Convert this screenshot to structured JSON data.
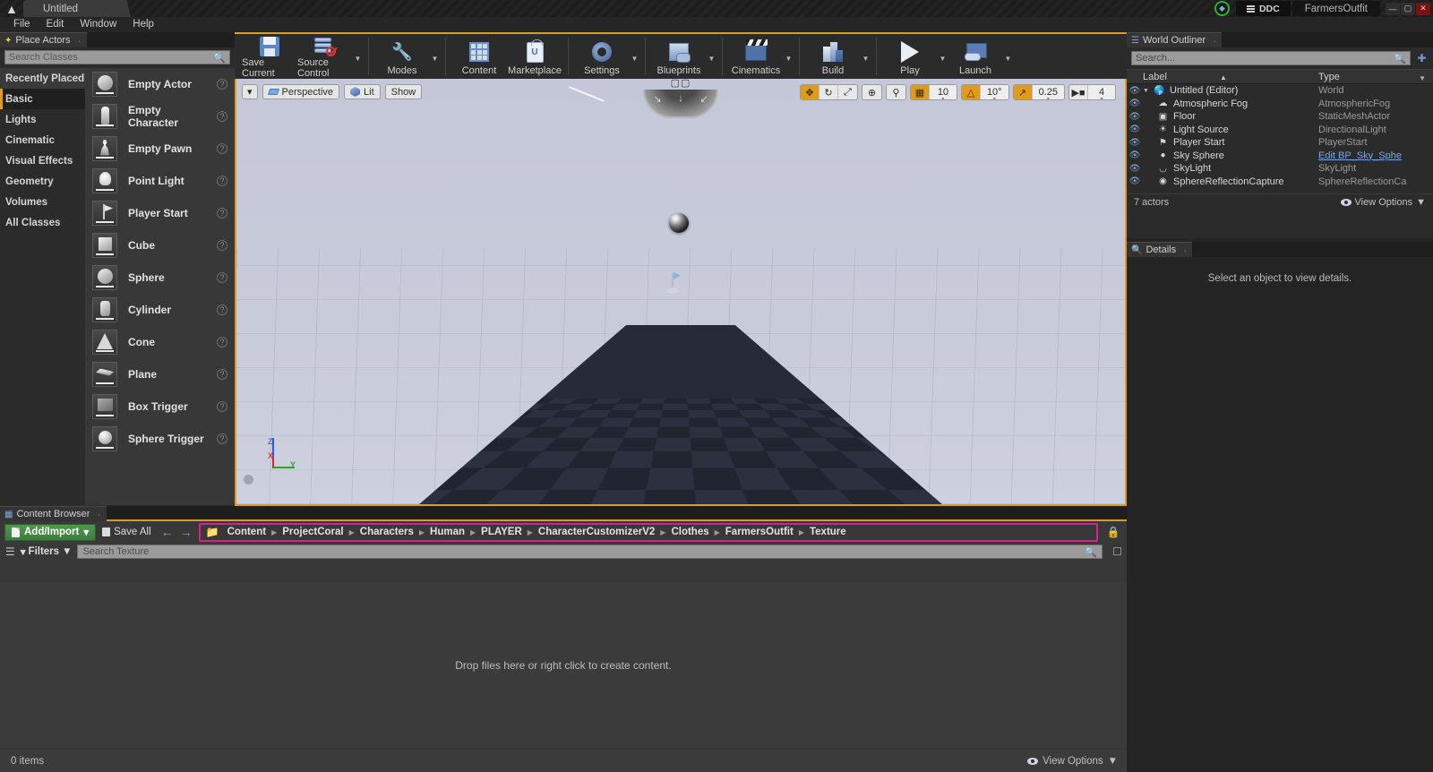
{
  "titlebar": {
    "project_tab": "Untitled",
    "ddc_label": "DDC",
    "window_label": "FarmersOutfit",
    "minimize": "—",
    "maximize": "▢",
    "close": "✕"
  },
  "menubar": {
    "items": [
      "File",
      "Edit",
      "Window",
      "Help"
    ]
  },
  "place_actors": {
    "tab_label": "Place Actors",
    "search_placeholder": "Search Classes",
    "categories": [
      {
        "label": "Recently Placed",
        "active": false,
        "highlight": true
      },
      {
        "label": "Basic",
        "active": true,
        "highlight": false
      },
      {
        "label": "Lights",
        "active": false,
        "highlight": false
      },
      {
        "label": "Cinematic",
        "active": false,
        "highlight": false
      },
      {
        "label": "Visual Effects",
        "active": false,
        "highlight": false
      },
      {
        "label": "Geometry",
        "active": false,
        "highlight": false
      },
      {
        "label": "Volumes",
        "active": false,
        "highlight": false
      },
      {
        "label": "All Classes",
        "active": false,
        "highlight": false
      }
    ],
    "actors": [
      {
        "label": "Empty Actor",
        "shape": "sphere"
      },
      {
        "label": "Empty Character",
        "shape": "char"
      },
      {
        "label": "Empty Pawn",
        "shape": "pawn"
      },
      {
        "label": "Point Light",
        "shape": "bulb"
      },
      {
        "label": "Player Start",
        "shape": "flag"
      },
      {
        "label": "Cube",
        "shape": "cube"
      },
      {
        "label": "Sphere",
        "shape": "sphere"
      },
      {
        "label": "Cylinder",
        "shape": "cyl"
      },
      {
        "label": "Cone",
        "shape": "cone"
      },
      {
        "label": "Plane",
        "shape": "plane"
      },
      {
        "label": "Box Trigger",
        "shape": "boxtrig"
      },
      {
        "label": "Sphere Trigger",
        "shape": "sphtrig"
      }
    ],
    "help_glyph": "?"
  },
  "toolbar": {
    "items": [
      {
        "label": "Save Current",
        "icon": "save-icon",
        "caret": false
      },
      {
        "label": "Source Control",
        "icon": "source-control-icon",
        "caret": true
      },
      {
        "label": "Modes",
        "icon": "modes-icon",
        "caret": true
      },
      {
        "label": "Content",
        "icon": "content-icon",
        "caret": false
      },
      {
        "label": "Marketplace",
        "icon": "marketplace-icon",
        "caret": false
      },
      {
        "label": "Settings",
        "icon": "settings-icon",
        "caret": true
      },
      {
        "label": "Blueprints",
        "icon": "blueprints-icon",
        "caret": true
      },
      {
        "label": "Cinematics",
        "icon": "cinematics-icon",
        "caret": true
      },
      {
        "label": "Build",
        "icon": "build-icon",
        "caret": true
      },
      {
        "label": "Play",
        "icon": "play-icon",
        "caret": true
      },
      {
        "label": "Launch",
        "icon": "launch-icon",
        "caret": true
      }
    ]
  },
  "viewport": {
    "view_mode_caret": "▾",
    "perspective": "Perspective",
    "lit": "Lit",
    "show": "Show",
    "controls": {
      "translate": "✥",
      "rotate": "↻",
      "scale": "⤢",
      "world": "⊕",
      "snap_actor": "⚲",
      "grid_snap": "▦",
      "grid_value": "10",
      "angle_snap": "△",
      "angle_value": "10°",
      "scale_snap": "↗",
      "scale_value": "0.25",
      "camera_icon": "🎥",
      "camera_speed": "4"
    },
    "axis": {
      "z": "Z",
      "x": "X",
      "y": "Y"
    },
    "compass_marks": "↓ ↓ ↓"
  },
  "world_outliner": {
    "tab_label": "World Outliner",
    "search_placeholder": "Search...",
    "columns": {
      "label": "Label",
      "type": "Type"
    },
    "rows": [
      {
        "label": "Untitled (Editor)",
        "type": "World",
        "icon": "world-icon",
        "depth": 0,
        "expandable": true,
        "link": false
      },
      {
        "label": "Atmospheric Fog",
        "type": "AtmosphericFog",
        "icon": "fog-icon",
        "depth": 1,
        "expandable": false,
        "link": false
      },
      {
        "label": "Floor",
        "type": "StaticMeshActor",
        "icon": "mesh-icon",
        "depth": 1,
        "expandable": false,
        "link": false
      },
      {
        "label": "Light Source",
        "type": "DirectionalLight",
        "icon": "light-icon",
        "depth": 1,
        "expandable": false,
        "link": false
      },
      {
        "label": "Player Start",
        "type": "PlayerStart",
        "icon": "playerstart-icon",
        "depth": 1,
        "expandable": false,
        "link": false
      },
      {
        "label": "Sky Sphere",
        "type": "Edit BP_Sky_Sphe",
        "icon": "sphere-icon",
        "depth": 1,
        "expandable": false,
        "link": true
      },
      {
        "label": "SkyLight",
        "type": "SkyLight",
        "icon": "skylight-icon",
        "depth": 1,
        "expandable": false,
        "link": false
      },
      {
        "label": "SphereReflectionCapture",
        "type": "SphereReflectionCa",
        "icon": "reflection-icon",
        "depth": 1,
        "expandable": false,
        "link": false
      }
    ],
    "actor_count": "7 actors",
    "view_options": "View Options"
  },
  "details": {
    "tab_label": "Details",
    "empty_message": "Select an object to view details."
  },
  "content_browser": {
    "tab_label": "Content Browser",
    "add_import": "Add/Import",
    "add_import_caret": "▾",
    "save_all": "Save All",
    "nav_back": "←",
    "nav_forward": "→",
    "breadcrumb": [
      "Content",
      "ProjectCoral",
      "Characters",
      "Human",
      "PLAYER",
      "CharacterCustomizerV2",
      "Clothes",
      "FarmersOutfit",
      "Texture"
    ],
    "breadcrumb_separator": "▶",
    "breadcrumb_highlight_color": "#d6228a",
    "filters_label": "Filters",
    "search_placeholder": "Search Texture",
    "empty_message": "Drop files here or right click to create content.",
    "item_count": "0 items",
    "view_options": "View Options"
  },
  "colors": {
    "accent_orange": "#e09a1c",
    "highlight_pink": "#d6228a",
    "panel_bg": "#2b2b2b",
    "content_bg": "#383838",
    "link_blue": "#7aa7e8",
    "green_button": "#4c9a4c"
  }
}
